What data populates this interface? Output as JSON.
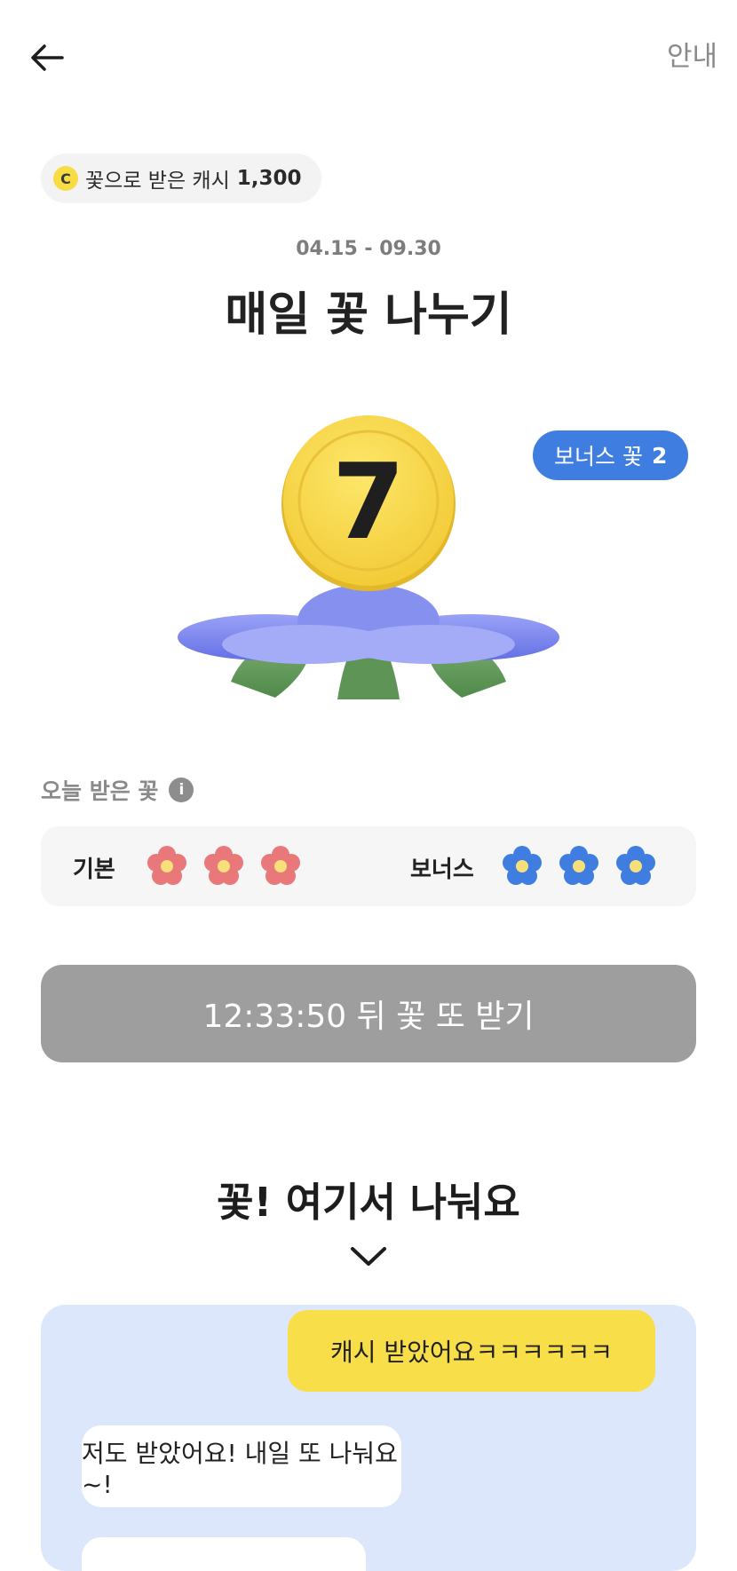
{
  "header": {
    "back_icon": "arrow-left-icon",
    "guide_label": "안내"
  },
  "cash_chip": {
    "coin_icon_letter": "C",
    "label": "꽃으로 받은 캐시",
    "amount": "1,300"
  },
  "event": {
    "period": "04.15 - 09.30",
    "title": "매일 꽃 나누기"
  },
  "hero": {
    "count": "7",
    "coin_color": "#f6d443",
    "flower_color": "#7b86ef",
    "bonus_pill": {
      "label": "보너스 꽃",
      "count": "2"
    }
  },
  "today": {
    "label": "오늘 받은 꽃",
    "info_icon": "info-icon",
    "basic": {
      "label": "기본",
      "count": 3,
      "color": "#e8787a"
    },
    "bonus": {
      "label": "보너스",
      "count": 3,
      "color": "#3f7ee0"
    }
  },
  "countdown_button": {
    "label": "12:33:50 뒤 꽃 또 받기"
  },
  "share": {
    "title": "꽃! 여기서 나눠요",
    "chevron_icon": "chevron-down-icon",
    "messages": [
      {
        "from": "me",
        "text": "캐시 받았어요ㅋㅋㅋㅋㅋㅋ"
      },
      {
        "from": "other",
        "text": "저도 받았어요! 내일 또 나눠요~!"
      }
    ]
  }
}
